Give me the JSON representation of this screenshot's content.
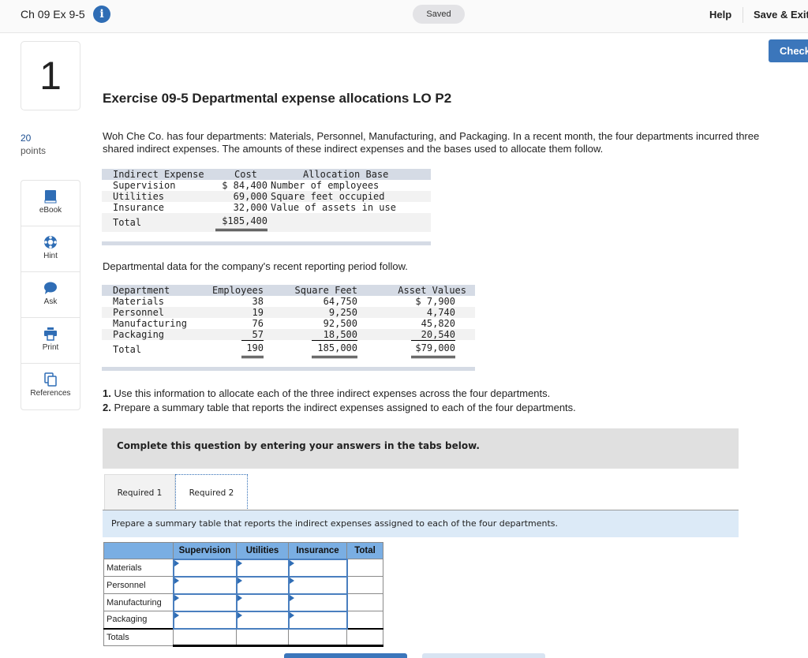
{
  "header": {
    "title": "Ch 09 Ex 9-5",
    "info_icon": "info-icon",
    "status": "Saved",
    "help": "Help",
    "save_exit": "Save & Exit",
    "check": "Check"
  },
  "question": {
    "number": "1",
    "points_value": "20",
    "points_label": "points"
  },
  "tools": [
    {
      "label": "eBook",
      "icon": "book-icon"
    },
    {
      "label": "Hint",
      "icon": "lifebuoy-icon"
    },
    {
      "label": "Ask",
      "icon": "speech-bubble-icon"
    },
    {
      "label": "Print",
      "icon": "printer-icon"
    },
    {
      "label": "References",
      "icon": "copies-icon"
    }
  ],
  "exercise": {
    "title": "Exercise 09-5 Departmental expense allocations LO P2",
    "intro": "Woh Che Co. has four departments: Materials, Personnel, Manufacturing, and Packaging. In a recent month, the four departments incurred three shared indirect expenses. The amounts of these indirect expenses and the bases used to allocate them follow.",
    "expense_table": {
      "headers": [
        "Indirect Expense",
        "Cost",
        "Allocation Base"
      ],
      "rows": [
        [
          "Supervision",
          "$ 84,400",
          "Number of employees"
        ],
        [
          "Utilities",
          "69,000",
          "Square feet occupied"
        ],
        [
          "Insurance",
          "32,000",
          "Value of assets in use"
        ]
      ],
      "total": [
        "Total",
        "$185,400"
      ]
    },
    "dept_intro": "Departmental data for the company's recent reporting period follow.",
    "dept_table": {
      "headers": [
        "Department",
        "Employees",
        "Square Feet",
        "Asset Values"
      ],
      "rows": [
        [
          "Materials",
          "38",
          "64,750",
          "$ 7,900"
        ],
        [
          "Personnel",
          "19",
          "9,250",
          "4,740"
        ],
        [
          "Manufacturing",
          "76",
          "92,500",
          "45,820"
        ],
        [
          "Packaging",
          "57",
          "18,500",
          "20,540"
        ]
      ],
      "total": [
        "Total",
        "190",
        "185,000",
        "$79,000"
      ]
    },
    "instructions": [
      {
        "num": "1.",
        "text": " Use this information to allocate each of the three indirect expenses across the four departments."
      },
      {
        "num": "2.",
        "text": " Prepare a summary table that reports the indirect expenses assigned to each of the four departments."
      }
    ]
  },
  "answer": {
    "banner": "Complete this question by entering your answers in the tabs below.",
    "tabs": [
      "Required 1",
      "Required 2"
    ],
    "active_tab": "Required 2",
    "prompt": "Prepare a summary table that reports the indirect expenses assigned to each of the four departments.",
    "table": {
      "headers": [
        "",
        "Supervision",
        "Utilities",
        "Insurance",
        "Total"
      ],
      "rows": [
        "Materials",
        "Personnel",
        "Manufacturing",
        "Packaging"
      ],
      "total_label": "Totals",
      "values": {}
    }
  },
  "colors": {
    "accent": "#3b76bb",
    "table_header": "#7aaee3",
    "prompt_bg": "#dceaf7"
  }
}
